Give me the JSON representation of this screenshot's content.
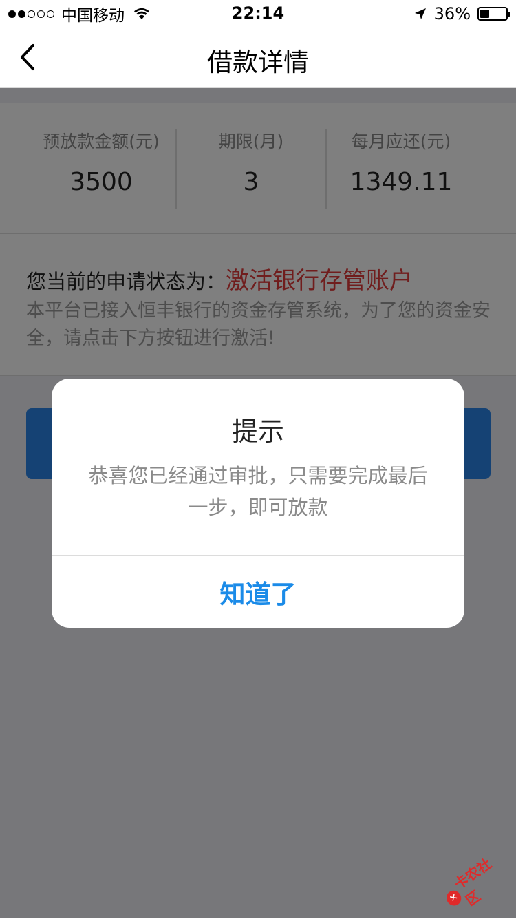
{
  "status_bar": {
    "carrier": "中国移动",
    "time": "22:14",
    "battery": "36%",
    "battery_level": 0.36
  },
  "nav": {
    "title": "借款详情",
    "back_icon": "chevron-left-icon"
  },
  "summary": [
    {
      "label": "预放款金额(元)",
      "value": "3500"
    },
    {
      "label": "期限(月)",
      "value": "3"
    },
    {
      "label": "每月应还(元)",
      "value": "1349.11"
    }
  ],
  "status": {
    "prefix": "您当前的申请状态为：",
    "value": "激活银行存管账户",
    "description": "本平台已接入恒丰银行的资金存管系统，为了您的资金安全，请点击下方按钮进行激活!"
  },
  "dialog": {
    "title": "提示",
    "message": "恭喜您已经通过审批，只需要完成最后一步，即可放款",
    "button": "知道了"
  },
  "watermark": {
    "text": "卡农社区"
  },
  "colors": {
    "accent_blue": "#1b8be8",
    "status_red": "#e03a3a",
    "button_blue": "#2a84e8"
  }
}
